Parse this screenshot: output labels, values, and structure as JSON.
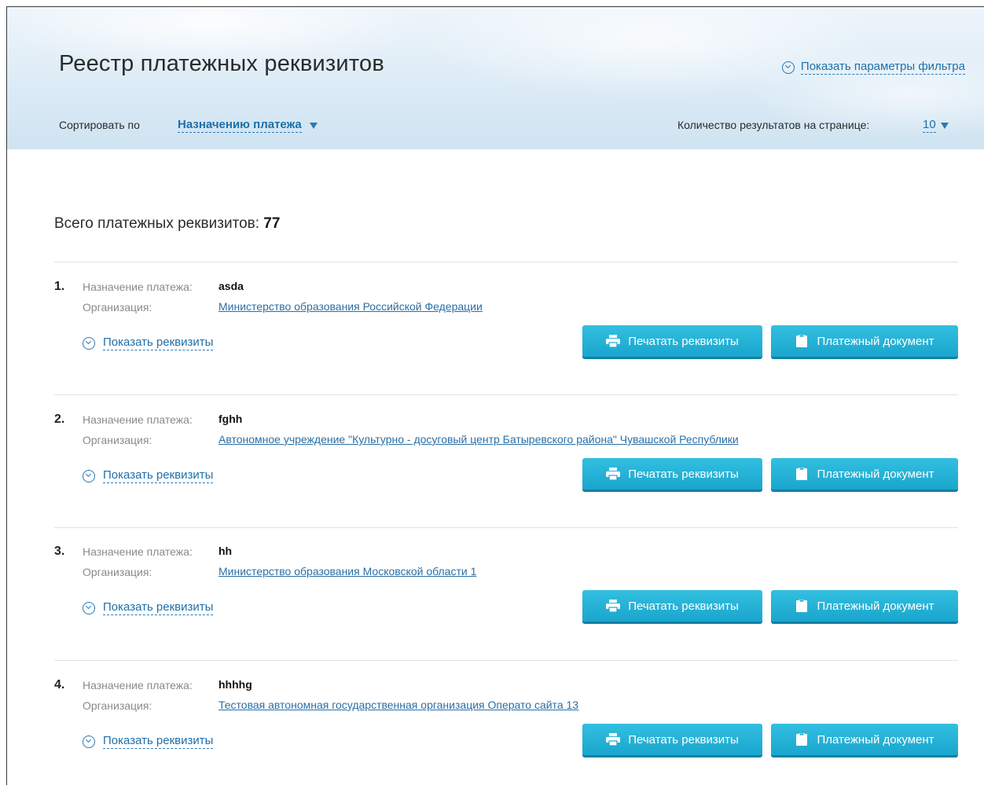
{
  "header": {
    "title": "Реестр платежных реквизитов",
    "filter_link": "Показать параметры фильтра",
    "sort_label": "Сортировать по",
    "sort_value": "Назначению платежа",
    "per_page_label": "Количество результатов на странице:",
    "per_page_value": "10"
  },
  "summary": {
    "total_label": "Всего платежных реквизитов:",
    "total_count": "77"
  },
  "labels": {
    "purpose": "Назначение платежа:",
    "organization": "Организация:",
    "show_details": "Показать реквизиты",
    "print_button": "Печатать реквизиты",
    "document_button": "Платежный документ"
  },
  "items": [
    {
      "num": "1.",
      "purpose": "asda",
      "organization": "Министерство образования Российской Федерации"
    },
    {
      "num": "2.",
      "purpose": "fghh",
      "organization": "Автономное учреждение \"Культурно - досуговый центр Батыревского района\" Чувашской Республики"
    },
    {
      "num": "3.",
      "purpose": "hh",
      "organization": "Министерство образования Московской области 1"
    },
    {
      "num": "4.",
      "purpose": "hhhhg",
      "organization": "Тестовая автономная государственная организация Операто сайта 13"
    }
  ],
  "icons": {
    "filter_toggle": "circle-chevron-down-icon",
    "sort_dropdown": "triangle-down-icon",
    "print": "printer-icon",
    "document": "clipboard-icon"
  },
  "colors": {
    "link": "#1f6fa8",
    "button": "#1aa6cd",
    "header_bg": "#dcebf6"
  }
}
